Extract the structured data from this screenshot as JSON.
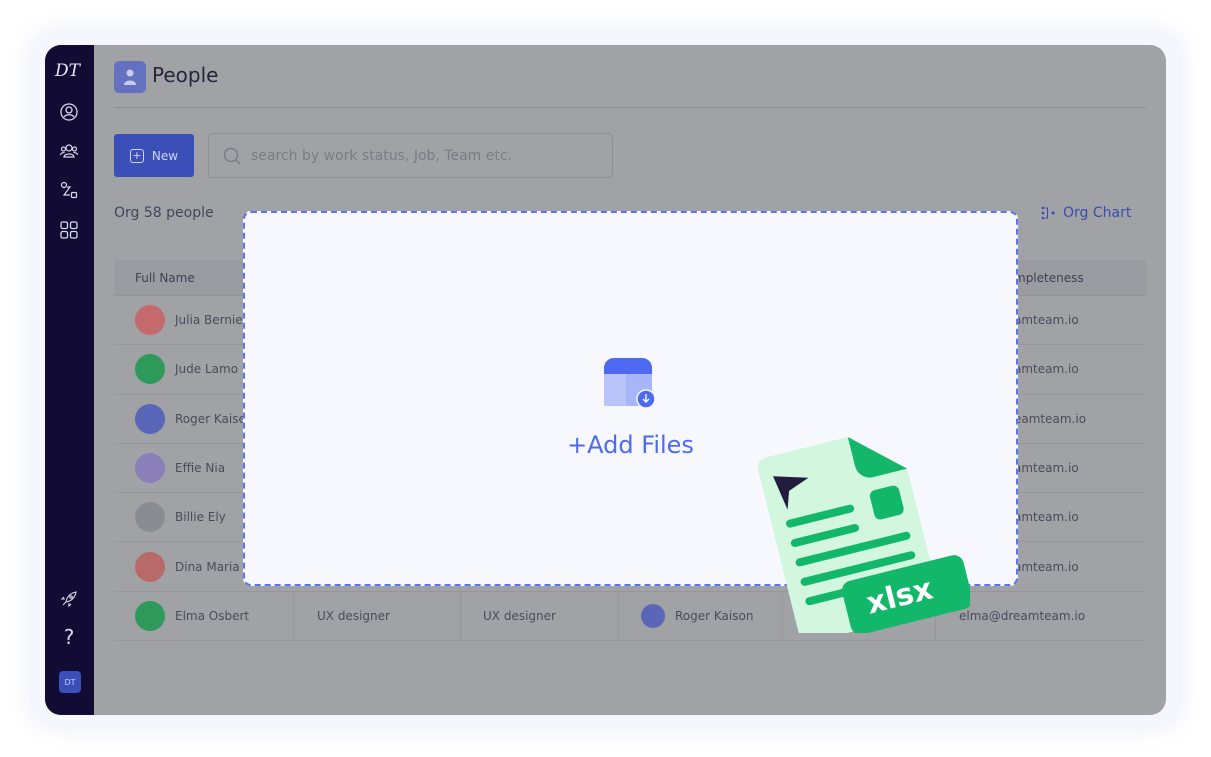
{
  "sidebar": {
    "logo": "DT",
    "items": [
      "profile-icon",
      "people-icon",
      "workflow-icon",
      "apps-icon"
    ],
    "bottom": [
      "rocket-icon",
      "help-icon"
    ],
    "user_initials": "DT"
  },
  "header": {
    "title": "People"
  },
  "toolbar": {
    "new_label": "New",
    "search_placeholder": "search by work status, Job, Team etc.",
    "count_text": "Org 58 people",
    "org_chart_label": "Org Chart"
  },
  "table": {
    "headers": [
      "Full Name",
      "mpleteness"
    ],
    "rows": [
      {
        "name": "Julia Bernie",
        "email": "amteam.io",
        "color": "#c46a6a"
      },
      {
        "name": "Jude Lamo",
        "email": "amteam.io",
        "color": "#2e9a5a"
      },
      {
        "name": "Roger Kaise",
        "email": "eamteam.io",
        "color": "#5a66b8"
      },
      {
        "name": "Effie Nia",
        "email": "amteam.io",
        "color": "#8a7fb8"
      },
      {
        "name": "Billie Ely",
        "email": "amteam.io",
        "color": "#8a8c94"
      },
      {
        "name": "Dina Maria",
        "email": "amteam.io",
        "color": "#b86a6a"
      },
      {
        "name": "Elma Osbert",
        "job": "UX designer",
        "title": "UX designer",
        "manager": "Roger Kaison",
        "email": "elma@dreamteam.io",
        "color": "#2e9a5a"
      }
    ]
  },
  "dropzone": {
    "label": "+Add Files",
    "badge": "xlsx"
  },
  "colors": {
    "accent": "#4d6af0",
    "sidebar": "#120c35",
    "excel_green": "#13b76a"
  }
}
